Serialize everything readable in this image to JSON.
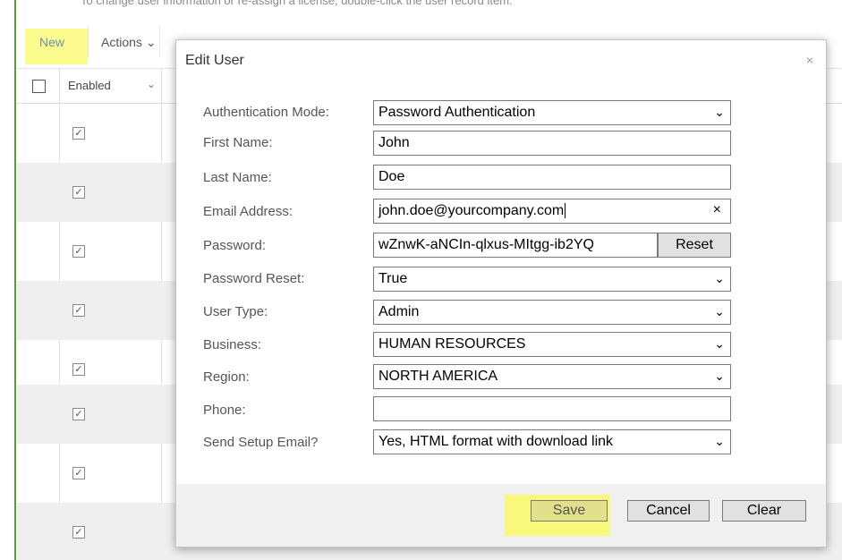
{
  "background": {
    "top_text": "To change user information or re-assign a license, double-click the user record item.",
    "toolbar": {
      "new_label": "New",
      "actions_label": "Actions",
      "actions_chevron": "⌄"
    },
    "grid": {
      "enabled_header": "Enabled",
      "check_mark": "✓"
    }
  },
  "modal": {
    "title": "Edit User",
    "close": "×",
    "fields": {
      "auth_mode": {
        "label": "Authentication Mode:",
        "value": "Password Authentication"
      },
      "first_name": {
        "label": "First Name:",
        "value": "John"
      },
      "last_name": {
        "label": "Last Name:",
        "value": "Doe"
      },
      "email": {
        "label": "Email Address:",
        "value": "john.doe@yourcompany.com",
        "clear": "×"
      },
      "password": {
        "label": "Password:",
        "value": "wZnwK-aNCIn-qlxus-MItgg-ib2YQ",
        "reset_label": "Reset"
      },
      "password_reset": {
        "label": "Password Reset:",
        "value": "True"
      },
      "user_type": {
        "label": "User Type:",
        "value": "Admin"
      },
      "business": {
        "label": "Business:",
        "value": "HUMAN RESOURCES"
      },
      "region": {
        "label": "Region:",
        "value": "NORTH AMERICA"
      },
      "phone": {
        "label": "Phone:",
        "value": ""
      },
      "setup_email": {
        "label": "Send Setup Email?",
        "value": "Yes, HTML format with download link"
      }
    },
    "buttons": {
      "save": "Save",
      "cancel": "Cancel",
      "clear": "Clear"
    }
  },
  "colors": {
    "highlight": "#f8f87a",
    "accent_green": "#5b9b3a"
  }
}
